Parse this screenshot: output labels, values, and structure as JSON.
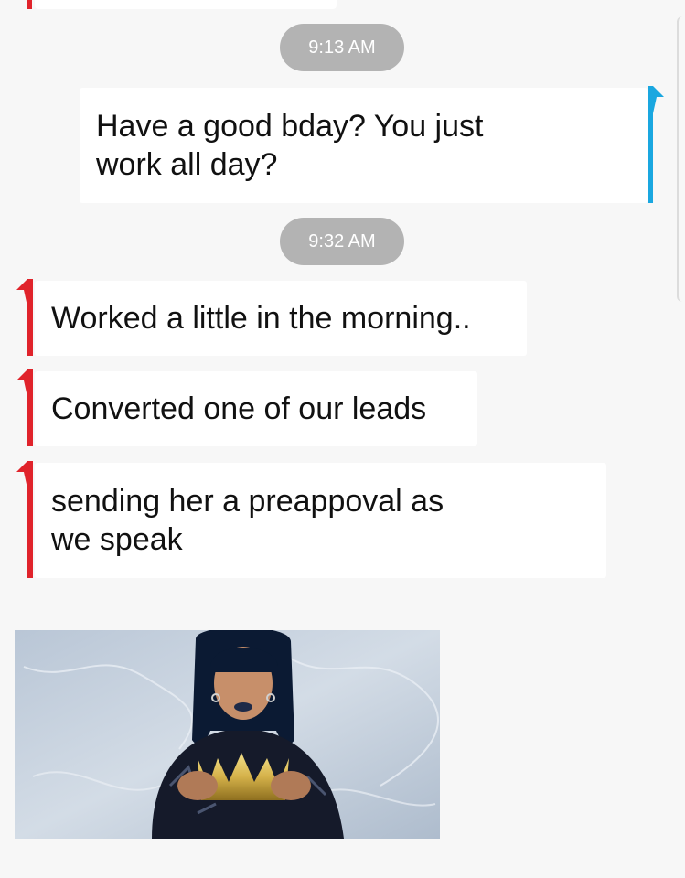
{
  "colors": {
    "sent_accent": "#1aa7e0",
    "received_accent": "#e0232b",
    "timestamp_bg": "#b3b3b3",
    "bubble_bg": "#ffffff",
    "screen_bg": "#f7f7f7"
  },
  "timestamps": [
    "9:13 AM",
    "9:32 AM"
  ],
  "messages": [
    {
      "direction": "sent",
      "lines": [
        "Have a good bday? You just",
        "work all day?"
      ]
    },
    {
      "direction": "received",
      "lines": [
        "Worked a little in the morning.."
      ]
    },
    {
      "direction": "received",
      "lines": [
        "Converted one of our leads"
      ]
    },
    {
      "direction": "received",
      "lines": [
        "sending her a preappoval as",
        "we speak"
      ]
    }
  ],
  "attachment": {
    "type": "gif",
    "subject": "woman-holding-golden-crown"
  }
}
